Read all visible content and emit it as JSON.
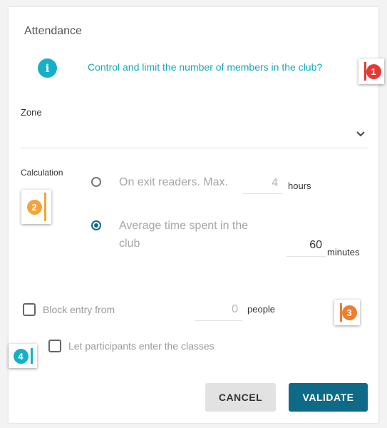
{
  "dialog": {
    "title": "Attendance",
    "info_link": "Control and limit the number of members in the club?"
  },
  "zone": {
    "label": "Zone",
    "value": ""
  },
  "calculation": {
    "label": "Calculation",
    "options": [
      {
        "label": "On exit readers. Max.",
        "value": "4",
        "unit": "hours",
        "selected": false
      },
      {
        "label_line1": "Average time spent in the",
        "label_line2": "club",
        "value": "60",
        "unit": "minutes",
        "selected": true
      }
    ]
  },
  "block_entry": {
    "label": "Block entry from",
    "value": "0",
    "unit": "people",
    "checked": false
  },
  "let_participants": {
    "label": "Let participants enter the classes",
    "checked": false
  },
  "annotations": [
    {
      "number": "1",
      "color": "#e53935"
    },
    {
      "number": "2",
      "color": "#f3a43b"
    },
    {
      "number": "3",
      "color": "#f07d2b"
    },
    {
      "number": "4",
      "color": "#14b0c5"
    }
  ],
  "buttons": {
    "cancel": "CANCEL",
    "validate": "VALIDATE"
  },
  "colors": {
    "accent": "#12a7bd",
    "primary": "#0e6a87"
  }
}
